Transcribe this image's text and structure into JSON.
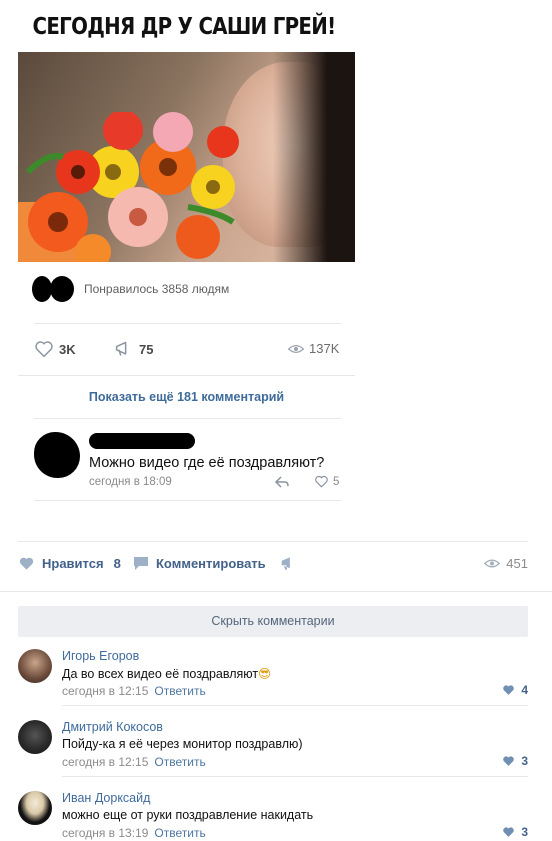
{
  "meme": {
    "title": "СЕГОДНЯ ДР У САШИ ГРЕЙ!"
  },
  "post_card": {
    "liked_by_text": "Понравилось 3858 людям",
    "likes": "3K",
    "shares": "75",
    "views": "137K",
    "show_more": "Показать ещё 181 комментарий",
    "comment": {
      "text": "Можно видео где её поздравляют?",
      "time": "сегодня в 18:09",
      "likes": "5"
    }
  },
  "actions": {
    "like_label": "Нравится",
    "like_count": "8",
    "comment_label": "Комментировать",
    "views": "451"
  },
  "hide_comments": "Скрыть комментарии",
  "comments": [
    {
      "name": "Игорь Егоров",
      "text": "Да во всех видео её поздравляют",
      "emoji": "😎",
      "time": "сегодня в 12:15",
      "reply": "Ответить",
      "likes": "4"
    },
    {
      "name": "Дмитрий Кокосов",
      "text": "Пойду-ка я её через монитор поздравлю)",
      "time": "сегодня в 12:15",
      "reply": "Ответить",
      "likes": "3"
    },
    {
      "name": "Иван Дорксайд",
      "text": "можно еще от руки поздравление накидать",
      "time": "сегодня в 13:19",
      "reply": "Ответить",
      "likes": "3"
    }
  ],
  "colors": {
    "link": "#3f6b9b",
    "accent": "#43628a",
    "muted": "#8b8b8b",
    "button_bg": "#eceef1"
  }
}
